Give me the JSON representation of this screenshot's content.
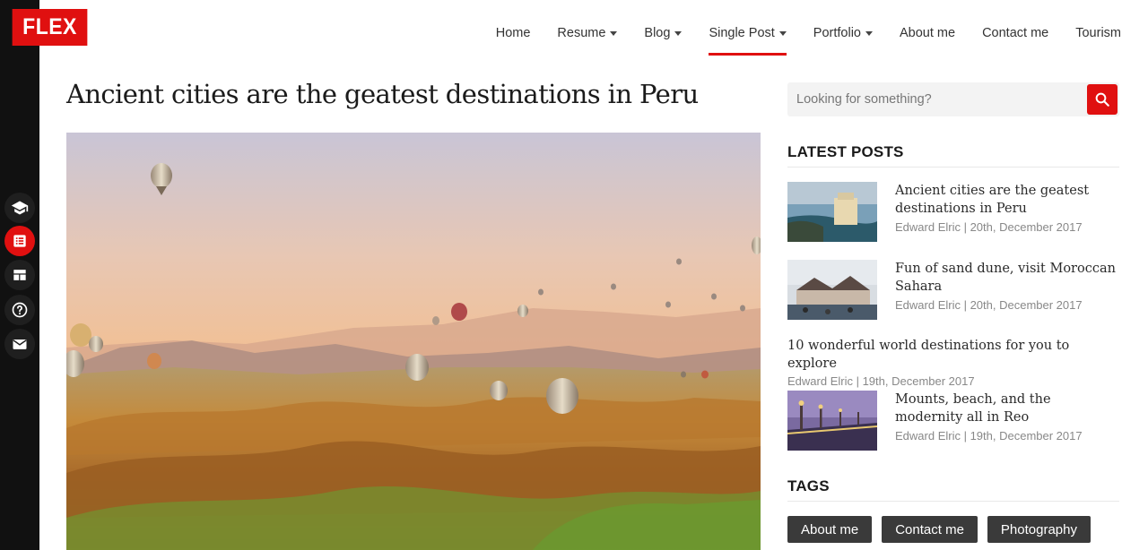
{
  "brand": {
    "logo_text": "FLEX",
    "accent": "#e01010"
  },
  "nav": {
    "items": [
      {
        "label": "Home",
        "dropdown": false,
        "active": false
      },
      {
        "label": "Resume",
        "dropdown": true,
        "active": false
      },
      {
        "label": "Blog",
        "dropdown": true,
        "active": false
      },
      {
        "label": "Single Post",
        "dropdown": true,
        "active": true
      },
      {
        "label": "Portfolio",
        "dropdown": true,
        "active": false
      },
      {
        "label": "About me",
        "dropdown": false,
        "active": false
      },
      {
        "label": "Contact me",
        "dropdown": false,
        "active": false
      },
      {
        "label": "Tourism",
        "dropdown": false,
        "active": false
      }
    ]
  },
  "rail": {
    "icons": [
      "graduation-cap-icon",
      "list-icon",
      "grid-layout-icon",
      "help-circle-icon",
      "mail-icon"
    ],
    "active_index": 1
  },
  "post": {
    "title": "Ancient cities are the geatest destinations in Peru",
    "hero_image": "hot-air-balloons-landscape"
  },
  "search": {
    "placeholder": "Looking for something?",
    "icon": "search-icon"
  },
  "latest_posts": {
    "heading": "LATEST POSTS",
    "items": [
      {
        "title": "Ancient cities are the geatest destinations in Peru",
        "author": "Edward Elric",
        "date": "20th, December 2017",
        "meta": "Edward Elric | 20th, December 2017",
        "thumb": "coastal-hotel"
      },
      {
        "title": "Fun of sand dune, visit Moroccan Sahara",
        "author": "Edward Elric",
        "date": "20th, December 2017",
        "meta": "Edward Elric | 20th, December 2017",
        "thumb": "temple-roofs"
      },
      {
        "title": "10 wonderful world destinations for you to explore",
        "author": "Edward Elric",
        "date": "19th, December 2017",
        "meta": "Edward Elric | 19th, December 2017",
        "thumb": null
      },
      {
        "title": "Mounts, beach, and the modernity all in Reo",
        "author": "Edward Elric",
        "date": "19th, December 2017",
        "meta": "Edward Elric | 19th, December 2017",
        "thumb": "bridge-dusk"
      }
    ]
  },
  "tags": {
    "heading": "TAGS",
    "items": [
      "About me",
      "Contact me",
      "Photography"
    ]
  }
}
